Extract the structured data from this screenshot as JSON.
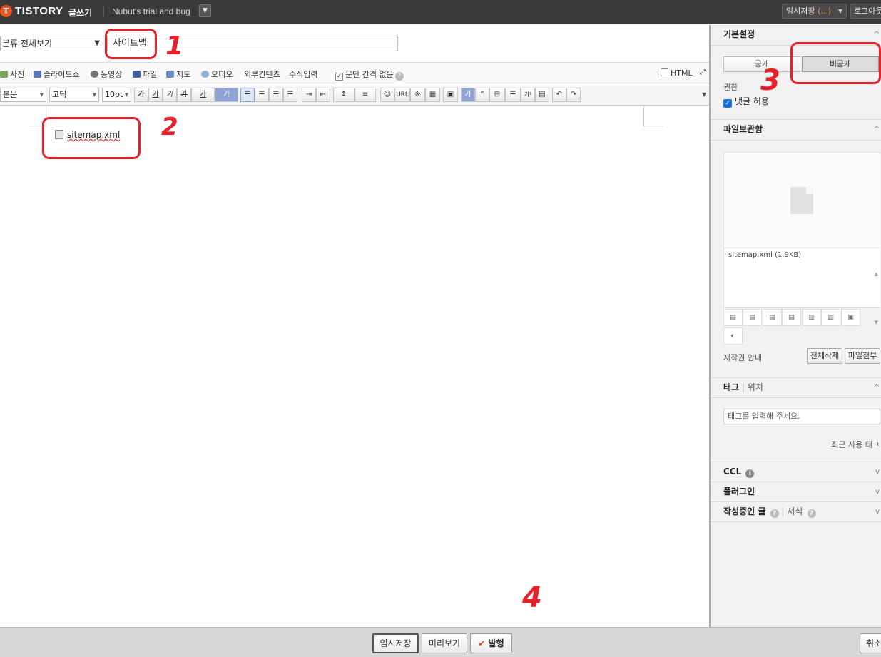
{
  "topbar": {
    "logo_letter": "T",
    "logo_text": "TISTORY",
    "write_label": "글쓰기",
    "blog_name": "Nubut's trial and bug",
    "blog_dd_icon": "chevron-down-icon",
    "draft_label": "임시저장",
    "draft_count": "(...)",
    "logout_label": "로그아웃"
  },
  "editor": {
    "category": "분류 전체보기",
    "title_value": "사이트맵",
    "toolbar1": {
      "photo": "사진",
      "slideshow": "슬라이드쇼",
      "video": "동영상",
      "file": "파일",
      "map": "지도",
      "audio": "오디오",
      "external": "외부컨텐츠",
      "formula": "수식입력",
      "no_spacing": "문단 간격 없음",
      "html": "HTML"
    },
    "toolbar2": {
      "style": "본문",
      "font": "고딕",
      "size": "10pt",
      "bold": "가",
      "underline": "가",
      "italic": "가",
      "strike": "가",
      "color": "가",
      "bg": "가",
      "url": "URL",
      "special": "※",
      "quote": "“",
      "sup": "가¹"
    },
    "attachment_name": "sitemap.xml"
  },
  "annotations": [
    "1",
    "2",
    "3",
    "4"
  ],
  "sidebar": {
    "basic_settings": "기본설정",
    "public": "공개",
    "private": "비공개",
    "permission": "권한",
    "allow_comments": "댓글 허용",
    "file_box": "파일보관함",
    "file_entry": "sitemap.xml (1.9KB)",
    "copyright": "저작권 안내",
    "delete_all": "전체삭제",
    "attach_file": "파일첨부",
    "tag": "태그",
    "location": "위치",
    "tag_placeholder": "태그를 입력해 주세요.",
    "recent_tags": "최근 사용 태그",
    "ccl": "CCL",
    "plugin": "플러그인",
    "writing": "작성중인 글",
    "format": "서식"
  },
  "bottom": {
    "save_draft": "임시저장",
    "preview": "미리보기",
    "publish": "발행",
    "cancel": "취소"
  },
  "colors": {
    "accent": "#eb531f",
    "annotation_red": "#e8202a"
  }
}
